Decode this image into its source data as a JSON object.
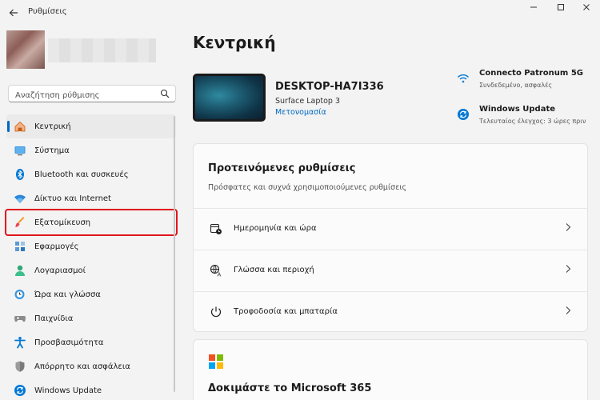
{
  "app": {
    "title": "Ρυθμίσεις"
  },
  "search": {
    "placeholder": "Αναζήτηση ρύθμισης"
  },
  "sidebar": {
    "items": [
      {
        "label": "Κεντρική",
        "icon": "home-icon"
      },
      {
        "label": "Σύστημα",
        "icon": "monitor-icon"
      },
      {
        "label": "Bluetooth και συσκευές",
        "icon": "bluetooth-icon"
      },
      {
        "label": "Δίκτυο και Internet",
        "icon": "wifi-icon"
      },
      {
        "label": "Εξατομίκευση",
        "icon": "brush-icon"
      },
      {
        "label": "Εφαρμογές",
        "icon": "apps-icon"
      },
      {
        "label": "Λογαριασμοί",
        "icon": "person-icon"
      },
      {
        "label": "Ώρα και γλώσσα",
        "icon": "globe-clock-icon"
      },
      {
        "label": "Παιχνίδια",
        "icon": "gamepad-icon"
      },
      {
        "label": "Προσβασιμότητα",
        "icon": "accessibility-icon"
      },
      {
        "label": "Απόρρητο και ασφάλεια",
        "icon": "shield-icon"
      },
      {
        "label": "Windows Update",
        "icon": "update-icon"
      }
    ]
  },
  "main": {
    "title": "Κεντρική",
    "device": {
      "name": "DESKTOP-HA7I336",
      "model": "Surface Laptop 3",
      "rename": "Μετονομασία"
    },
    "network": {
      "title": "Connecto Patronum 5G",
      "subtitle": "Συνδεδεμένο, ασφαλές"
    },
    "update": {
      "title": "Windows Update",
      "subtitle": "Τελευταίος έλεγχος: 3 ώρες πριν"
    },
    "recommended": {
      "title": "Προτεινόμενες ρυθμίσεις",
      "subtitle": "Πρόσφατες και συχνά χρησιμοποιούμενες ρυθμίσεις",
      "rows": [
        {
          "label": "Ημερομηνία και ώρα"
        },
        {
          "label": "Γλώσσα και περιοχή"
        },
        {
          "label": "Τροφοδοσία και μπαταρία"
        }
      ]
    },
    "m365": {
      "title": "Δοκιμάστε το Microsoft 365"
    }
  },
  "colors": {
    "accent": "#0067c0",
    "highlight": "#e0151c"
  }
}
